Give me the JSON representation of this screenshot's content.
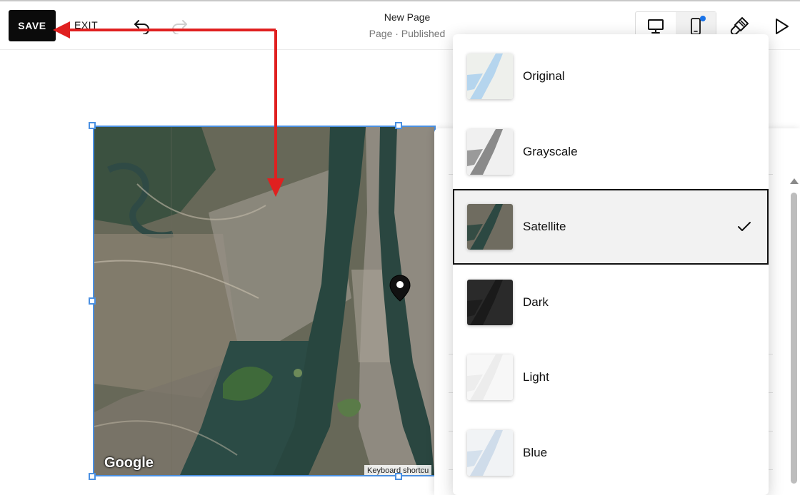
{
  "toolbar": {
    "save_label": "SAVE",
    "exit_label": "EXIT",
    "page_title": "New Page",
    "page_status": "Page · Published",
    "undo_icon": "undo-icon",
    "redo_icon": "redo-icon",
    "desktop_icon": "desktop-icon",
    "mobile_icon": "mobile-icon",
    "brush_icon": "paintbrush-icon",
    "preview_icon": "play-icon",
    "notification_color": "#1a73e8"
  },
  "map": {
    "provider_logo": "Google",
    "keyboard_shortcuts": "Keyboard shortcu",
    "pin_icon": "map-pin-icon",
    "selection_color": "#4a90e2"
  },
  "map_styles": {
    "options": [
      {
        "label": "Original",
        "selected": false
      },
      {
        "label": "Grayscale",
        "selected": false
      },
      {
        "label": "Satellite",
        "selected": true
      },
      {
        "label": "Dark",
        "selected": false
      },
      {
        "label": "Light",
        "selected": false
      },
      {
        "label": "Blue",
        "selected": false
      }
    ],
    "check_icon": "checkmark-icon"
  },
  "annotation": {
    "arrow_color": "#e02020"
  }
}
